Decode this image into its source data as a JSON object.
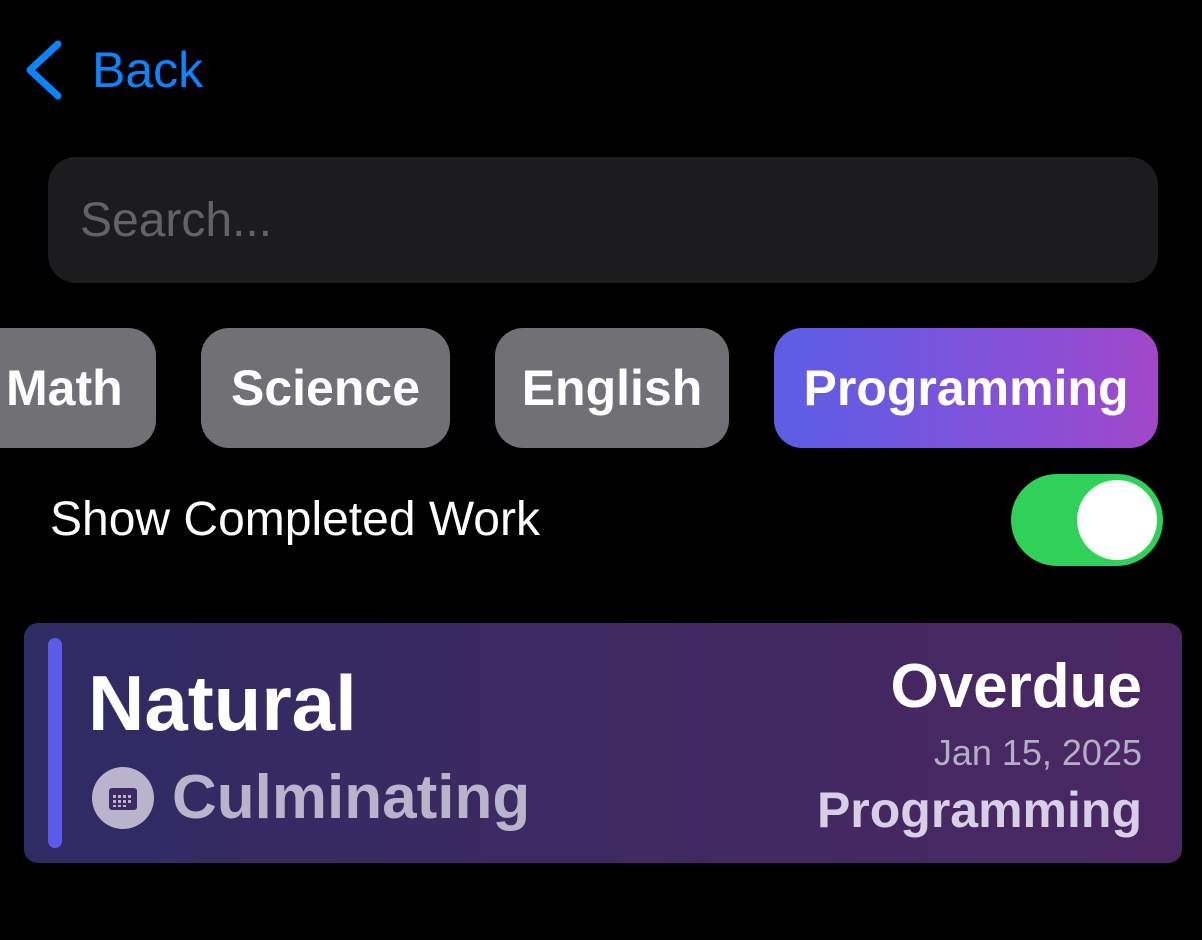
{
  "nav": {
    "back_label": "Back"
  },
  "search": {
    "placeholder": "Search...",
    "value": ""
  },
  "subject_filters": [
    {
      "label": "Math",
      "selected": false
    },
    {
      "label": "Science",
      "selected": false
    },
    {
      "label": "English",
      "selected": false
    },
    {
      "label": "Programming",
      "selected": true
    }
  ],
  "show_completed": {
    "label": "Show Completed Work",
    "enabled": true
  },
  "assignments": [
    {
      "title": "Natural",
      "type": "Culminating",
      "type_icon": "calendar-icon",
      "status": "Overdue",
      "date": "Jan 15, 2025",
      "subject": "Programming"
    }
  ],
  "colors": {
    "accent_blue": "#0a84ff",
    "toggle_on": "#30d158",
    "chip_inactive": "#717175",
    "chip_active_start": "#5b5ee6",
    "chip_active_end": "#a247c9",
    "card_accent": "#5a5ce8"
  }
}
